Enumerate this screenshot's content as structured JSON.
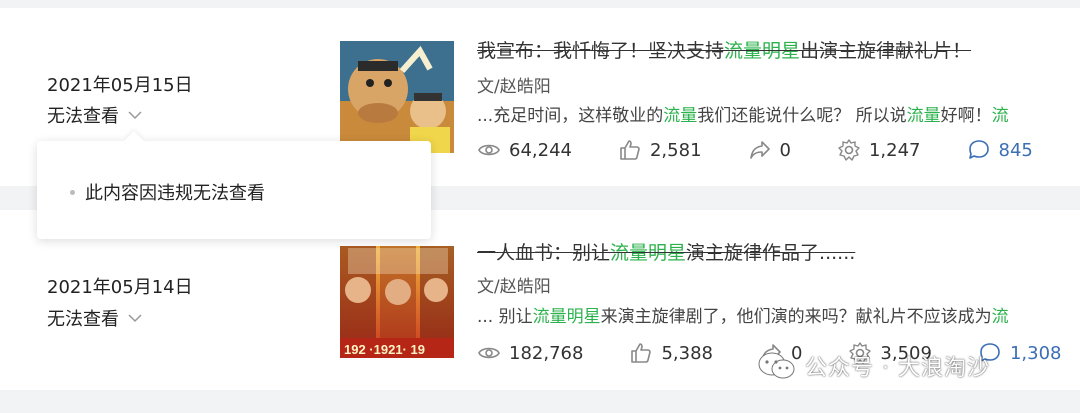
{
  "articles": [
    {
      "date": "2021年05月15日",
      "status": "无法查看",
      "title_pre": "我宣布：我忏悔了！坚决支持",
      "title_hl": "流量明星",
      "title_post": "出演主旋律献礼片！",
      "author": "文/赵皓阳",
      "excerpt_pre": "...充足时间，这样敬业的",
      "excerpt_hl1": "流量",
      "excerpt_mid": "我们还能说什么呢？ 所以说",
      "excerpt_hl2": "流量",
      "excerpt_post": "好啊！",
      "excerpt_hl3": "流",
      "views": "64,244",
      "likes": "2,581",
      "shares": "0",
      "favorites": "1,247",
      "comments": "845"
    },
    {
      "date": "2021年05月14日",
      "status": "无法查看",
      "title_pre": "一人血书：别让",
      "title_hl": "流量明星",
      "title_post": "演主旋律作品了......",
      "author": "文/赵皓阳",
      "excerpt_pre": "... 别让",
      "excerpt_hl1": "流量明星",
      "excerpt_mid": "来演主旋律剧了，他们演的来吗？献礼片不应该成为",
      "excerpt_hl2": "流",
      "views": "182,768",
      "likes": "5,388",
      "shares": "0",
      "favorites": "3,509",
      "comments": "1,308"
    }
  ],
  "popup": {
    "message": "此内容因违规无法查看"
  },
  "watermark": {
    "text": "公众号 · 大浪淘沙"
  },
  "colors": {
    "highlight": "#2bb24c",
    "comment_accent": "#3b6fb6"
  }
}
